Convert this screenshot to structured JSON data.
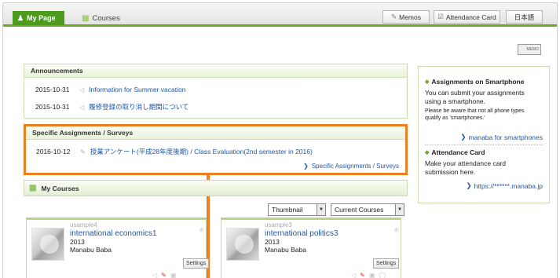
{
  "nav": {
    "my_page": "My Page",
    "courses": "Courses",
    "memos": "Memos",
    "attendance_card": "Attendance Card",
    "language": "日本語",
    "memo_icon_text": "MEMO"
  },
  "announcements": {
    "title": "Announcements",
    "items": [
      {
        "date": "2015-10-31",
        "text": "Information for Summer vacation"
      },
      {
        "date": "2015-10-31",
        "text": "履修登録の取り消し期間について"
      }
    ]
  },
  "assignments": {
    "title": "Specific Assignments / Surveys",
    "items": [
      {
        "date": "2016-10-12",
        "text": "授業アンケート(平成28年度後期) / Class Evaluation(2nd semester in 2016)"
      }
    ],
    "more_link": "Specific Assignments / Surveys"
  },
  "my_courses": {
    "title": "My Courses",
    "view_select": "Thumbnail",
    "filter_select": "Current Courses",
    "settings_label": "Settings",
    "cards": [
      {
        "code": "usample4",
        "name": "international economics1",
        "year": "2013",
        "teacher": "Manabu Baba"
      },
      {
        "code": "usample3",
        "name": "international politics3",
        "year": "2013",
        "teacher": "Manabu Baba"
      }
    ]
  },
  "sidebar": {
    "smartphone": {
      "title": "Assignments on Smartphone",
      "line1": "You can submit your assignments",
      "line2": "using a smartphone.",
      "note1": "Please be aware that not all phone types",
      "note2": "qualify as 'smartphones.'",
      "link": "manaba for smartphones"
    },
    "attendance": {
      "title": "Attendance Card",
      "line1": "Make your attendance card",
      "line2": "submission here.",
      "link": "https://******.manaba.jp"
    }
  },
  "colors": {
    "accent_green": "#4d9a1e",
    "highlight_orange": "#f07d1e",
    "link_blue": "#1f57a6"
  }
}
